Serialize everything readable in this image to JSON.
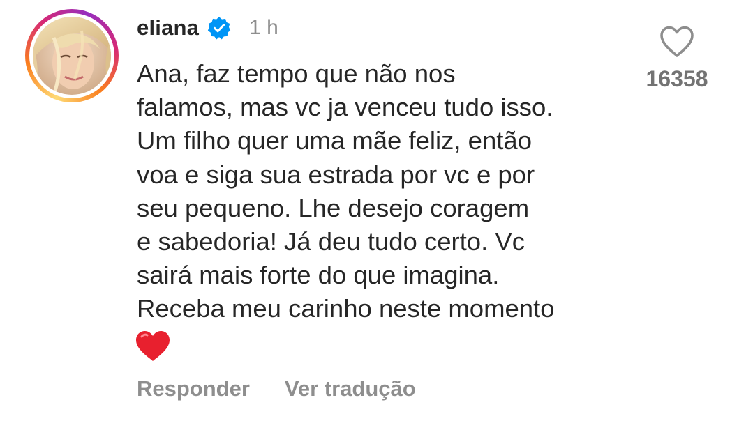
{
  "comment": {
    "author": "eliana",
    "time": "1 h",
    "text_lines": [
      "Ana, faz tempo que não nos",
      "falamos, mas vc ja venceu tudo isso.",
      "Um filho quer uma mãe feliz, então",
      "voa e siga sua estrada por vc e por",
      "seu pequeno. Lhe desejo coragem",
      "e sabedoria! Já deu tudo certo. Vc",
      "sairá mais forte do que imagina.",
      "Receba meu carinho neste momento"
    ],
    "emoji": "red-heart",
    "reply_label": "Responder",
    "translate_label": "Ver tradução",
    "likes": "16358"
  },
  "icons": {
    "verified": "verified-badge-icon",
    "like": "heart-outline-icon"
  },
  "colors": {
    "verified_blue": "#0095f6",
    "heart_red": "#e8202e",
    "muted_text": "#8e8e8e"
  }
}
